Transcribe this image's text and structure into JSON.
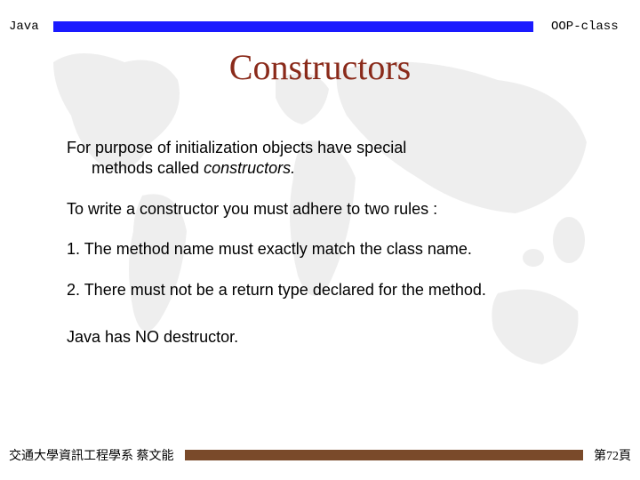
{
  "header": {
    "left": "Java",
    "right": "OOP-class"
  },
  "title": "Constructors",
  "body": {
    "intro_line1": "For purpose of initialization objects have special",
    "intro_line2_a": "methods called ",
    "intro_line2_b": "constructors.",
    "lead": "To write a constructor you must adhere to two rules :",
    "rule1": "1.  The method name must exactly match the class name.",
    "rule2": "2.  There must not be a return type declared for the method.",
    "closing": "Java has NO destructor."
  },
  "footer": {
    "left": "交通大學資訊工程學系 蔡文能",
    "right": "第72頁"
  },
  "colors": {
    "header_bar": "#1a1aff",
    "footer_bar": "#7a4a2a",
    "title": "#8a2a1a"
  }
}
